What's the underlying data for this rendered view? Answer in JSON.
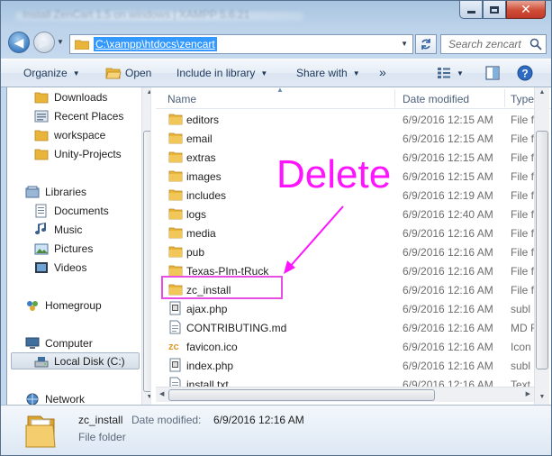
{
  "window": {
    "title": "Install ZenCart 1.5 on windows | XAMPP 5.6.21"
  },
  "nav": {
    "address": "C:\\xampp\\htdocs\\zencart",
    "search_placeholder": "Search zencart"
  },
  "toolbar": {
    "organize": "Organize",
    "open": "Open",
    "include_library": "Include in library",
    "share_with": "Share with",
    "more": "»"
  },
  "sidebar": {
    "items": [
      {
        "label": "Downloads",
        "icon": "folder-icon"
      },
      {
        "label": "Recent Places",
        "icon": "recent-places-icon"
      },
      {
        "label": "workspace",
        "icon": "folder-icon"
      },
      {
        "label": "Unity-Projects",
        "icon": "folder-icon"
      },
      {
        "label": "Libraries",
        "icon": "libraries-icon"
      },
      {
        "label": "Documents",
        "icon": "documents-icon"
      },
      {
        "label": "Music",
        "icon": "music-icon"
      },
      {
        "label": "Pictures",
        "icon": "pictures-icon"
      },
      {
        "label": "Videos",
        "icon": "videos-icon"
      },
      {
        "label": "Homegroup",
        "icon": "homegroup-icon"
      },
      {
        "label": "Computer",
        "icon": "computer-icon"
      },
      {
        "label": "Local Disk (C:)",
        "icon": "drive-icon"
      },
      {
        "label": "Network",
        "icon": "network-icon"
      }
    ]
  },
  "columns": {
    "name": "Name",
    "date": "Date modified",
    "type": "Type"
  },
  "files": [
    {
      "name": "editors",
      "date": "6/9/2016 12:15 AM",
      "type": "File f",
      "icon": "folder-icon"
    },
    {
      "name": "email",
      "date": "6/9/2016 12:15 AM",
      "type": "File f",
      "icon": "folder-icon"
    },
    {
      "name": "extras",
      "date": "6/9/2016 12:15 AM",
      "type": "File f",
      "icon": "folder-icon"
    },
    {
      "name": "images",
      "date": "6/9/2016 12:15 AM",
      "type": "File f",
      "icon": "folder-icon"
    },
    {
      "name": "includes",
      "date": "6/9/2016 12:19 AM",
      "type": "File f",
      "icon": "folder-icon"
    },
    {
      "name": "logs",
      "date": "6/9/2016 12:40 AM",
      "type": "File f",
      "icon": "folder-icon"
    },
    {
      "name": "media",
      "date": "6/9/2016 12:16 AM",
      "type": "File f",
      "icon": "folder-icon"
    },
    {
      "name": "pub",
      "date": "6/9/2016 12:16 AM",
      "type": "File f",
      "icon": "folder-icon"
    },
    {
      "name": "Texas-PIm-tRuck",
      "date": "6/9/2016 12:16 AM",
      "type": "File f",
      "icon": "folder-icon"
    },
    {
      "name": "zc_install",
      "date": "6/9/2016 12:16 AM",
      "type": "File f",
      "icon": "folder-icon"
    },
    {
      "name": "ajax.php",
      "date": "6/9/2016 12:16 AM",
      "type": "subl",
      "icon": "php-file-icon"
    },
    {
      "name": "CONTRIBUTING.md",
      "date": "6/9/2016 12:16 AM",
      "type": "MD F",
      "icon": "text-file-icon"
    },
    {
      "name": "favicon.ico",
      "date": "6/9/2016 12:16 AM",
      "type": "Icon",
      "icon": "zencart-icon"
    },
    {
      "name": "index.php",
      "date": "6/9/2016 12:16 AM",
      "type": "subl",
      "icon": "php-file-icon"
    },
    {
      "name": "install.txt",
      "date": "6/9/2016 12:16 AM",
      "type": "Text",
      "icon": "text-file-icon"
    }
  ],
  "annotation": {
    "note": "Delete",
    "color": "#ff14ff"
  },
  "details": {
    "name": "zc_install",
    "modified_label": "Date modified:",
    "modified_value": "6/9/2016 12:16 AM",
    "type": "File folder"
  },
  "colors": {
    "address_selection": "#3399ff",
    "highlight_box": "#e84ee3",
    "folder": "#e8b53a"
  }
}
